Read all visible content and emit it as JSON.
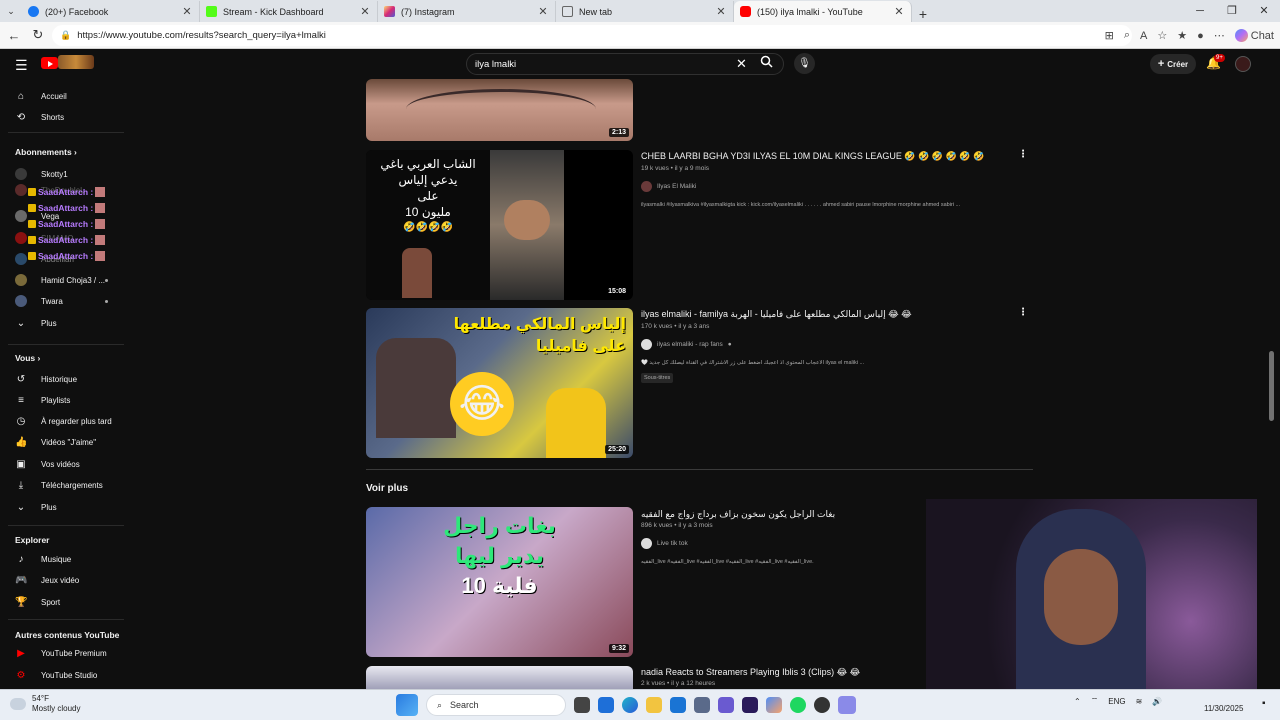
{
  "browser": {
    "tabs": [
      {
        "title": "(20+) Facebook",
        "color": "#1877f2"
      },
      {
        "title": "Stream - Kick Dashboard",
        "color": "#53fc18"
      },
      {
        "title": "(7) Instagram",
        "color": "#d6249f"
      },
      {
        "title": "New tab",
        "color": "#888888"
      },
      {
        "title": "(150) ilya lmalki - YouTube",
        "color": "#ff0000",
        "active": true
      }
    ],
    "url": "https://www.youtube.com/results?search_query=ilya+lmalki",
    "chat_label": "Chat"
  },
  "masthead": {
    "search_value": "ilya lmalki",
    "create_label": "Créer",
    "notif_count": "9+"
  },
  "sidebar": {
    "home": "Accueil",
    "shorts": "Shorts",
    "subs_header": "Abonnements",
    "subscriptions": [
      {
        "name": "Skotty1"
      },
      {
        "name": "TheDoubleL"
      },
      {
        "name": "Vega"
      },
      {
        "name": "SIMAMO"
      },
      {
        "name": "Abdelilah"
      },
      {
        "name": "Hamid Choja3 / ..."
      },
      {
        "name": "Twara"
      }
    ],
    "more1": "Plus",
    "you_header": "Vous",
    "you_items": [
      "Historique",
      "Playlists",
      "À regarder plus tard",
      "Vidéos \"J'aime\"",
      "Vos vidéos",
      "Téléchargements",
      "Plus"
    ],
    "explore_header": "Explorer",
    "explore_items": [
      "Musique",
      "Jeux vidéo",
      "Sport"
    ],
    "other_header": "Autres contenus YouTube",
    "other_items": [
      "YouTube Premium",
      "YouTube Studio"
    ],
    "chat_overlay_name": "SaadAttarch :"
  },
  "results": [
    {
      "duration": "2:13"
    },
    {
      "title": "CHEB LAARBI BGHA YD3I ILYAS EL 10M DIAL KINGS LEAGUE 🤣 🤣 🤣 🤣 🤣 🤣",
      "meta": "19 k vues • il y a 9 mois",
      "channel": "Ilyas El Maliki",
      "desc": "ilyasmalki #ilyasmalkiva #ilyasmalkigta kick : kick.com/ilyaselmaliki . . . . . . ahmed sabiri pause lmorphine morphine ahmed sabiri ...",
      "duration": "15:08",
      "thumb_text": [
        "الشاب العربي باغي",
        "يدعي إلياس",
        "على",
        "10 مليون",
        "🤣🤣🤣🤣"
      ]
    },
    {
      "title": "ilyas elmaliki - familya إلياس المالكي مطلعها على فاميليا - الهربة 😂 😂",
      "meta": "170 k vues • il y a 3 ans",
      "channel": "ilyas elmaliki - rap fans",
      "desc": "🤍 الاعجاب المحتوى اذ اعجبك اضغط على زر الاشتراك في القناة ليصلك كل جديد ilyas el maliki ...",
      "tag": "Sous-titres",
      "duration": "25:20",
      "thumb_text": [
        "إلياس المالكي مطلعها",
        "على فاميليا"
      ]
    }
  ],
  "voir_plus": "Voir plus",
  "more_results": [
    {
      "title": "بغات الراجل يكون سخون بزاف برداج زواج مع الفقيه",
      "meta": "896 k vues • il y a 3 mois",
      "channel": "Live tik tok",
      "desc": "الفقيه_live #الفقيه_live #الفقيه_live #الفقيه_live #الفقيه_live #الفقيه_live.",
      "duration": "9:32",
      "thumb_text": [
        "بغات راجل",
        "يدير ليها",
        "10 فلية"
      ]
    },
    {
      "title": "nadia Reacts to Streamers Playing Iblis 3 (Clips) 😂 😂",
      "meta": "2 k vues • il y a 12 heures"
    }
  ],
  "taskbar": {
    "temp": "54°F",
    "weather": "Mostly cloudy",
    "search_label": "Search",
    "lang": "ENG",
    "date": "11/30/2025"
  }
}
